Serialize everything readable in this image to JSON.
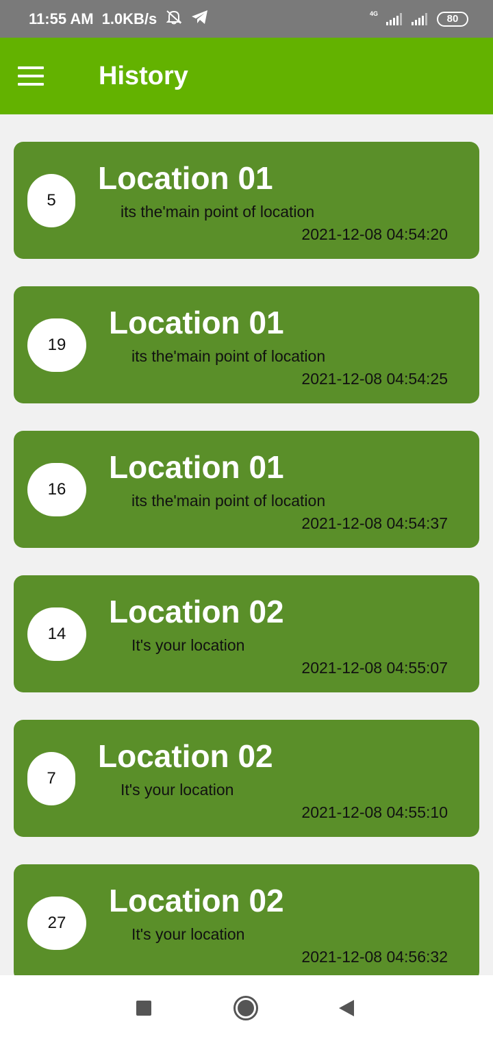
{
  "status_bar": {
    "time": "11:55 AM",
    "speed": "1.0KB/s",
    "network_label": "4G",
    "battery": "80",
    "icons": [
      "mute-icon",
      "telegram-icon",
      "signal-icon",
      "signal-icon",
      "battery-icon"
    ]
  },
  "app_bar": {
    "title": "History",
    "menu_icon": "hamburger-menu-icon",
    "background": "#63b200"
  },
  "colors": {
    "card": "#5a8f29",
    "page": "#f1f1f1"
  },
  "history": [
    {
      "count": "5",
      "title": "Location 01",
      "subtitle": "its the'main point of location",
      "timestamp": "2021-12-08 04:54:20"
    },
    {
      "count": "19",
      "title": "Location 01",
      "subtitle": "its the'main point of location",
      "timestamp": "2021-12-08 04:54:25"
    },
    {
      "count": "16",
      "title": "Location 01",
      "subtitle": "its the'main point of location",
      "timestamp": "2021-12-08 04:54:37"
    },
    {
      "count": "14",
      "title": "Location 02",
      "subtitle": "It's your location",
      "timestamp": "2021-12-08 04:55:07"
    },
    {
      "count": "7",
      "title": "Location 02",
      "subtitle": "It's your location",
      "timestamp": "2021-12-08 04:55:10"
    },
    {
      "count": "27",
      "title": "Location 02",
      "subtitle": "It's your location",
      "timestamp": "2021-12-08 04:56:32"
    }
  ],
  "nav_bar": {
    "icons": [
      "recents-square-icon",
      "home-circle-icon",
      "back-triangle-icon"
    ]
  }
}
